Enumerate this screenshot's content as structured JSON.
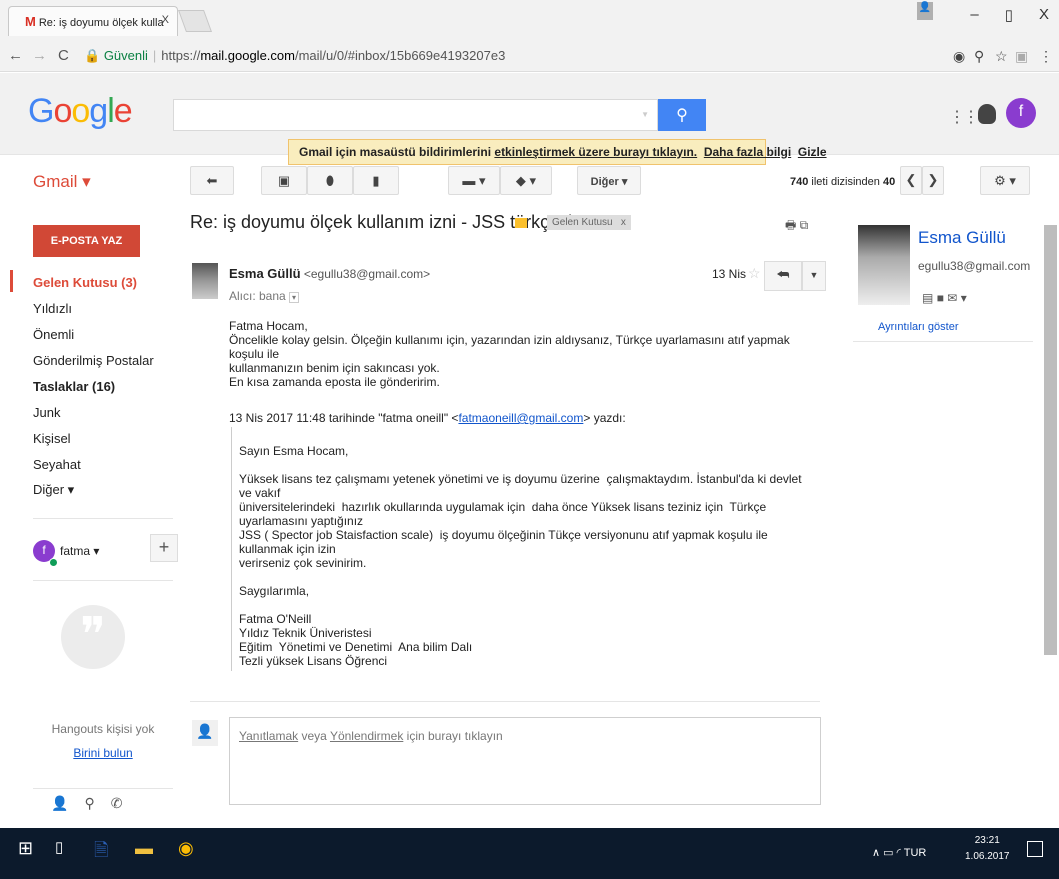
{
  "browser": {
    "tab_title": "Re: iş doyumu ölçek kulla",
    "tab_close": "X",
    "security_label": "Güvenli",
    "url_scheme": "https://",
    "url_host": "mail.google.com",
    "url_path": "/mail/u/0/#inbox/15b669e4193207e3",
    "win_min": "–",
    "win_max": "▯",
    "win_close": "X"
  },
  "header": {
    "logo_letters": [
      "G",
      "o",
      "o",
      "g",
      "l",
      "e"
    ],
    "search_placeholder": "",
    "profile_initial": "f"
  },
  "notice": {
    "prefix": "Gmail için masaüstü bildirimlerini ",
    "link1": "etkinleştirmek üzere burayı tıklayın.",
    "link2": "Daha fazla bilgi",
    "link3": "Gizle"
  },
  "toolbar": {
    "gmail_label": "Gmail ▾",
    "more_label": "Diğer ▾",
    "counter_pre": "740",
    "counter_mid": " ileti dizisinden ",
    "counter_num": "40"
  },
  "sidebar": {
    "compose_label": "E-POSTA YAZ",
    "items": [
      {
        "label": "Gelen Kutusu (3)"
      },
      {
        "label": "Yıldızlı"
      },
      {
        "label": "Önemli"
      },
      {
        "label": "Gönderilmiş Postalar"
      },
      {
        "label": "Taslaklar (16)"
      },
      {
        "label": "Junk"
      },
      {
        "label": "Kişisel"
      },
      {
        "label": "Seyahat"
      },
      {
        "label": "Diğer ▾"
      }
    ],
    "hangouts_user": "fatma ▾",
    "hangouts_initial": "f",
    "hangouts_empty": "Hangouts kişisi yok",
    "hangouts_find": "Birini bulun"
  },
  "message": {
    "subject": "Re: iş doyumu ölçek kullanım izni - JSS türkçesi",
    "label": "Gelen Kutusu   x",
    "sender_name": "Esma Güllü",
    "sender_email": " <egullu38@gmail.com>",
    "recipient": "Alıcı: bana",
    "date": "13 Nis",
    "body": "Fatma Hocam,\nÖncelikle kolay gelsin. Ölçeğin kullanımı için, yazarından izin aldıysanız, Türkçe uyarlamasını atıf yapmak koşulu ile\nkullanmanızın benim için sakıncası yok.\nEn kısa zamanda eposta ile gönderirim.",
    "wrote_prefix": "13 Nis 2017 11:48 tarihinde \"fatma oneill\" <",
    "wrote_email": "fatmaoneill@gmail.com",
    "wrote_suffix": "> yazdı:",
    "quoted": "Sayın Esma Hocam,\n\nYüksek lisans tez çalışmamı yetenek yönetimi ve iş doyumu üzerine  çalışmaktaydım. İstanbul'da ki devlet ve vakıf\nüniversitelerindeki  hazırlık okullarında uygulamak için  daha önce Yüksek lisans teziniz için  Türkçe uyarlamasını yaptığınız\nJSS ( Spector job Staisfaction scale)  iş doyumu ölçeğinin Tükçe versiyonunu atıf yapmak koşulu ile  kullanmak için izin\nverirseniz çok sevinirim.\n\nSaygılarımla,\n\nFatma O'Neill\nYıldız Teknik Üniveristesi\nEğitim  Yönetimi ve Denetimi  Ana bilim Dalı\nTezli yüksek Lisans Öğrenci",
    "reply_link1": "Yanıtlamak",
    "reply_mid": " veya ",
    "reply_link2": "Yönlendirmek",
    "reply_suffix": " için burayı tıklayın"
  },
  "contact": {
    "name": "Esma Güllü",
    "email": "egullu38@gmail.com",
    "details": "Ayrıntıları göster"
  },
  "taskbar": {
    "lang": "TUR",
    "time": "23:21",
    "date": "1.06.2017"
  }
}
